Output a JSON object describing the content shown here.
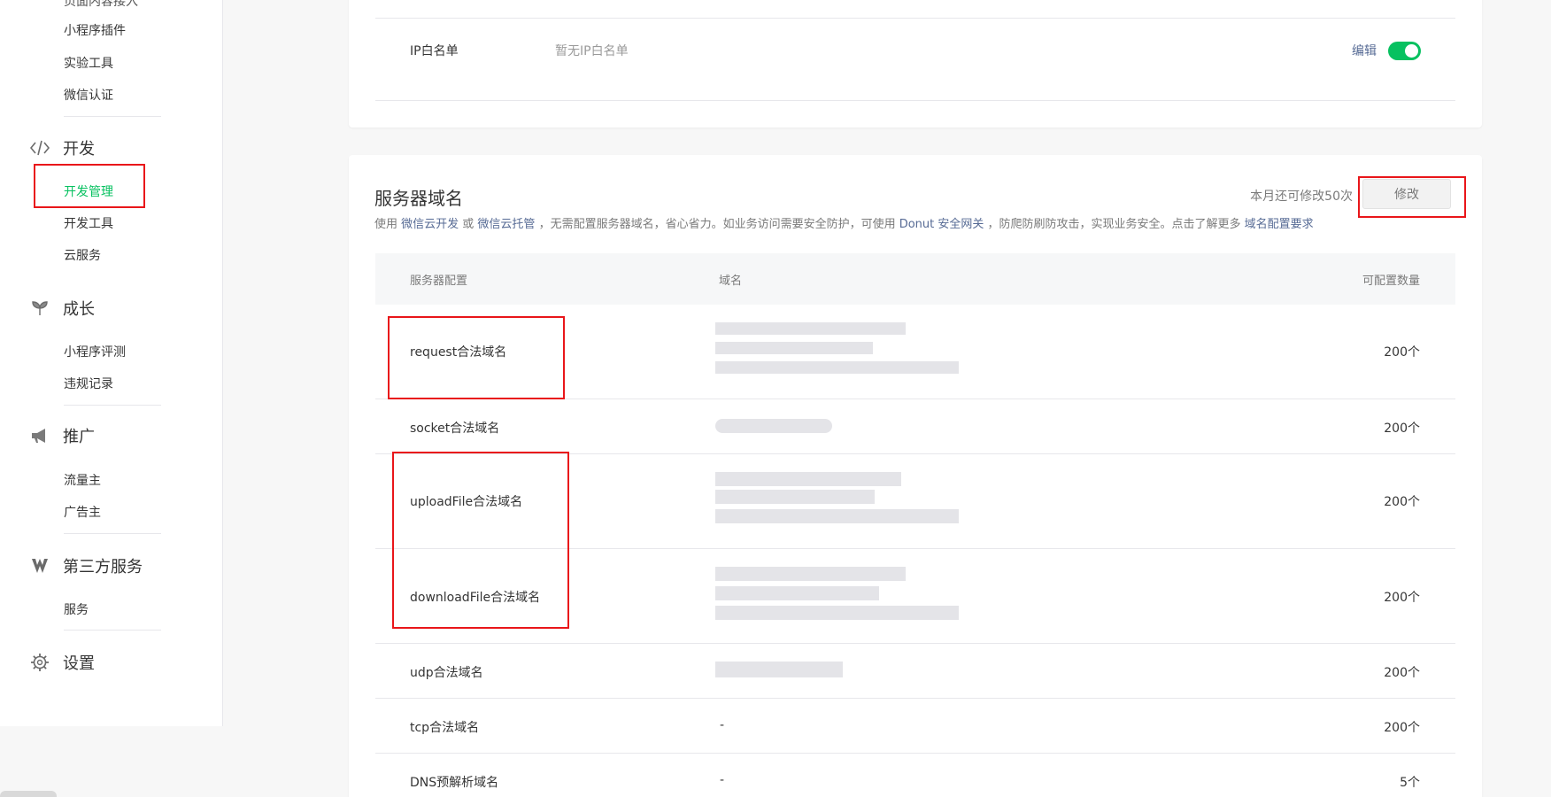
{
  "sidebar": {
    "cut_item": "页面内容接入",
    "basic_items": [
      "小程序插件",
      "实验工具",
      "微信认证"
    ],
    "sections": [
      {
        "label": "开发",
        "icon": "code-icon",
        "items": [
          "开发管理",
          "开发工具",
          "云服务"
        ],
        "active": "开发管理"
      },
      {
        "label": "成长",
        "icon": "sprout-icon",
        "items": [
          "小程序评测",
          "违规记录"
        ]
      },
      {
        "label": "推广",
        "icon": "megaphone-icon",
        "items": [
          "流量主",
          "广告主"
        ]
      },
      {
        "label": "第三方服务",
        "icon": "third-party-icon",
        "items": [
          "服务"
        ]
      },
      {
        "label": "设置",
        "icon": "gear-icon",
        "items": []
      }
    ]
  },
  "ip_whitelist": {
    "label": "IP白名单",
    "value": "暂无IP白名单",
    "edit_label": "编辑",
    "enabled": true
  },
  "server_domain": {
    "title": "服务器域名",
    "quota_text": "本月还可修改50次",
    "modify_label": "修改",
    "desc": {
      "t1": "使用 ",
      "l1": "微信云开发",
      "t2": " 或 ",
      "l2": "微信云托管",
      "t3": " ，无需配置服务器域名，省心省力。如业务访问需要安全防护，可使用 ",
      "l3": "Donut 安全网关",
      "t4": " ，防爬防刷防攻击，实现业务安全。点击了解更多 ",
      "l4": "域名配置要求"
    },
    "columns": [
      "服务器配置",
      "域名",
      "可配置数量"
    ],
    "rows": [
      {
        "config": "request合法域名",
        "domain": "",
        "count": "200个"
      },
      {
        "config": "socket合法域名",
        "domain": "",
        "count": "200个"
      },
      {
        "config": "uploadFile合法域名",
        "domain": "",
        "count": "200个"
      },
      {
        "config": "downloadFile合法域名",
        "domain": "",
        "count": "200个"
      },
      {
        "config": "udp合法域名",
        "domain": "",
        "count": "200个"
      },
      {
        "config": "tcp合法域名",
        "domain": "-",
        "count": "200个"
      },
      {
        "config": "DNS预解析域名",
        "domain": "-",
        "count": "5个"
      }
    ]
  },
  "colors": {
    "accent_green": "#07c160",
    "link_blue": "#576b95",
    "highlight_red": "#e9161a"
  }
}
